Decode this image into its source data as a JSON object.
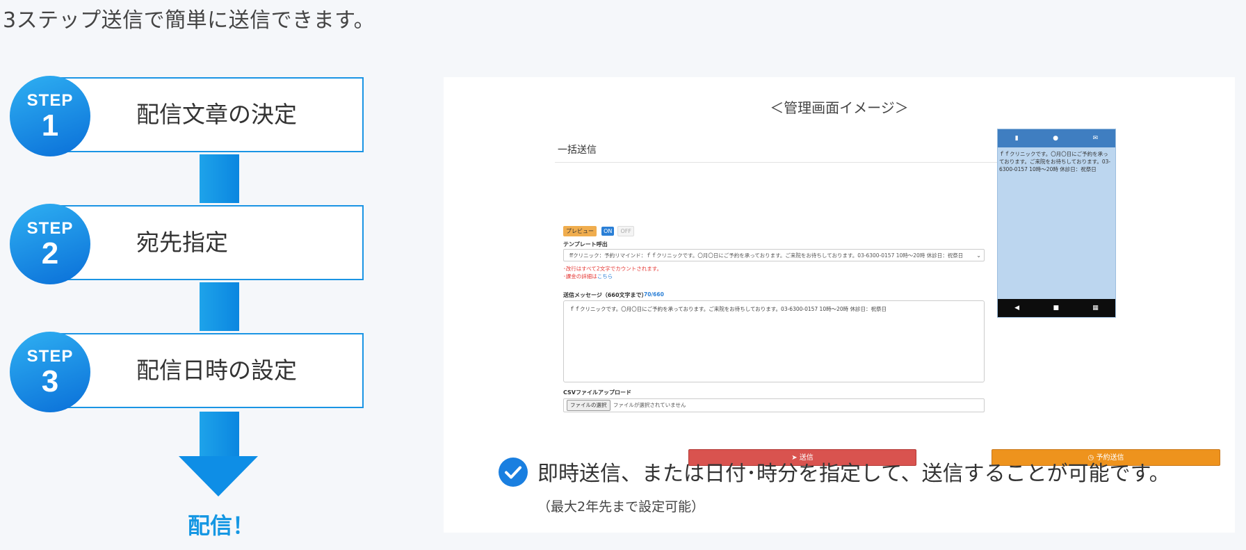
{
  "headline": "3ステップ送信で簡単に送信できます。",
  "steps": [
    {
      "label": "STEP",
      "number": "1",
      "title": "配信文章の決定"
    },
    {
      "label": "STEP",
      "number": "2",
      "title": "宛先指定"
    },
    {
      "label": "STEP",
      "number": "3",
      "title": "配信日時の設定"
    }
  ],
  "delivery_label": "配信！",
  "panel": {
    "title": "＜管理画面イメージ＞",
    "screen": {
      "heading": "一括送信",
      "preview_badge": "プレビュー",
      "toggle_on": "ON",
      "toggle_off": "OFF",
      "template_label": "テンプレート呼出",
      "template_value": "ffクリニック：予約リマインド：ｆｆクリニックです。〇月〇日にご予約を承っております。ご来院をお待ちしております。03-6300-0157 10時〜20時 休診日：祝祭日",
      "note_1": "･改行はすべて2文字でカウントされます。",
      "note_2_prefix": "･課金の詳細は",
      "note_2_link": "こちら",
      "message_label": "送信メッセージ（660文字まで）",
      "message_count": "70/660",
      "message_value": "ｆｆクリニックです。〇月〇日にご予約を承っております。ご来院をお待ちしております。03-6300-0157 10時〜20時 休診日：祝祭日",
      "csv_label": "CSVファイルアップロード",
      "file_button": "ファイルの選択",
      "file_status": "ファイルが選択されていません",
      "phone_message": "ｆｆクリニックです。〇月〇日にご予約を承っております。ご来院をお待ちしております。03-6300-0157 10時〜20時 休診日：祝祭日",
      "send_button": "送信",
      "schedule_button": "予約送信"
    },
    "note_main": "即時送信、または日付･時分を指定して、送信することが可能です。",
    "note_sub": "（最大2年先まで設定可能）"
  },
  "colors": {
    "accent": "#1a94e4",
    "send": "#d9534f",
    "schedule": "#ee931d",
    "background": "#f5f7fa"
  }
}
